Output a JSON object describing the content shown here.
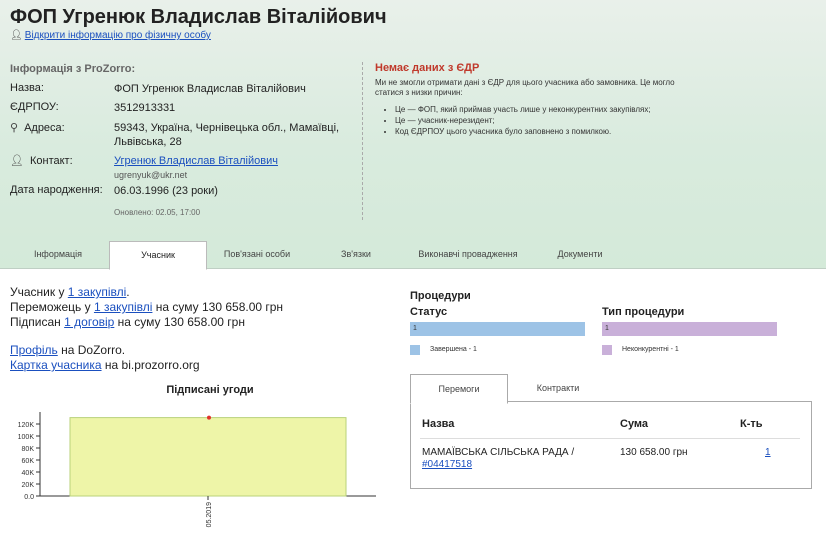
{
  "header": {
    "title": "ФОП Угренюк Владислав Віталійович",
    "open_info_link": "Відкрити інформацію про фізичну особу",
    "section_title": "Інформація з ProZorro:",
    "fields": {
      "name_label": "Назва:",
      "name_value": "ФОП Угренюк Владислав Віталійович",
      "edrpou_label": "ЄДРПОУ:",
      "edrpou_value": "3512913331",
      "address_label": "Адреса:",
      "address_value": "59343, Україна, Чернівецька обл., Мамаївці, Львівська, 28",
      "contact_label": "Контакт:",
      "contact_name": "Угренюк Владислав Віталійович",
      "contact_email": "ugrenyuk@ukr.net",
      "birth_label": "Дата народження:",
      "birth_value": "06.03.1996 (23 роки)"
    },
    "updated": "Оновлено: 02.05, 17:00",
    "edr": {
      "title": "Немає даних з ЄДР",
      "text": "Ми не змогли отримати дані з ЄДР для цього учасника або замовника. Це могло статися з низки причин:",
      "reasons": [
        "Це — ФОП, який приймав участь лише у неконкурентних закупівлях;",
        "Це — учасник-нерезидент;",
        "Код ЄДРПОУ цього учасника було заповнено з помилкою."
      ]
    }
  },
  "tabs": [
    {
      "label": "Інформація",
      "active": false
    },
    {
      "label": "Учасник",
      "active": true
    },
    {
      "label": "Пов'язані особи",
      "active": false
    },
    {
      "label": "Зв'язки",
      "active": false
    },
    {
      "label": "Виконавчі провадження",
      "active": false
    },
    {
      "label": "Документи",
      "active": false
    }
  ],
  "summary": {
    "l1_pre": "Учасник у ",
    "l1_link": "1 закупівлі",
    "l1_post": ".",
    "l2_pre": "Переможець у ",
    "l2_link": "1 закупівлі",
    "l2_post": " на суму 130 658.00 грн",
    "l3_pre": "Підписан ",
    "l3_link": "1 договір",
    "l3_post": " на суму 130 658.00 грн",
    "profile_link": "Профіль",
    "profile_post": " на DoZorro.",
    "card_link": "Картка учасника",
    "card_post": " на bi.prozorro.org"
  },
  "chart_data": {
    "type": "bar",
    "title": "Підписані угоди",
    "categories": [
      "05.2019"
    ],
    "values": [
      130658
    ],
    "ylim": [
      0,
      130000
    ],
    "yticks": [
      0,
      20000,
      40000,
      60000,
      80000,
      100000,
      120000
    ],
    "ytick_labels": [
      "0.0",
      "20K",
      "40K",
      "60K",
      "80K",
      "100K",
      "120K"
    ],
    "bar_color": "#eef5a8",
    "bar_edge": "#b9d27a",
    "marker_color": "#e0322a"
  },
  "procedures": {
    "title": "Процедури",
    "status_title": "Статус",
    "status_bar_value": "1",
    "status_color": "#9dc3e6",
    "status_legend": "Завершена - 1",
    "type_title": "Тип процедури",
    "type_bar_value": "1",
    "type_color": "#c9b0d9",
    "type_legend": "Неконкурентні - 1"
  },
  "panel": {
    "tabs": [
      "Перемоги",
      "Контракти"
    ],
    "headers": {
      "name": "Назва",
      "sum": "Сума",
      "count": "К-ть"
    },
    "rows": [
      {
        "name": "МАМАЇВСЬКА СІЛЬСЬКА РАДА /",
        "code": "#04417518",
        "sum": "130 658.00 грн",
        "count": "1"
      }
    ]
  }
}
